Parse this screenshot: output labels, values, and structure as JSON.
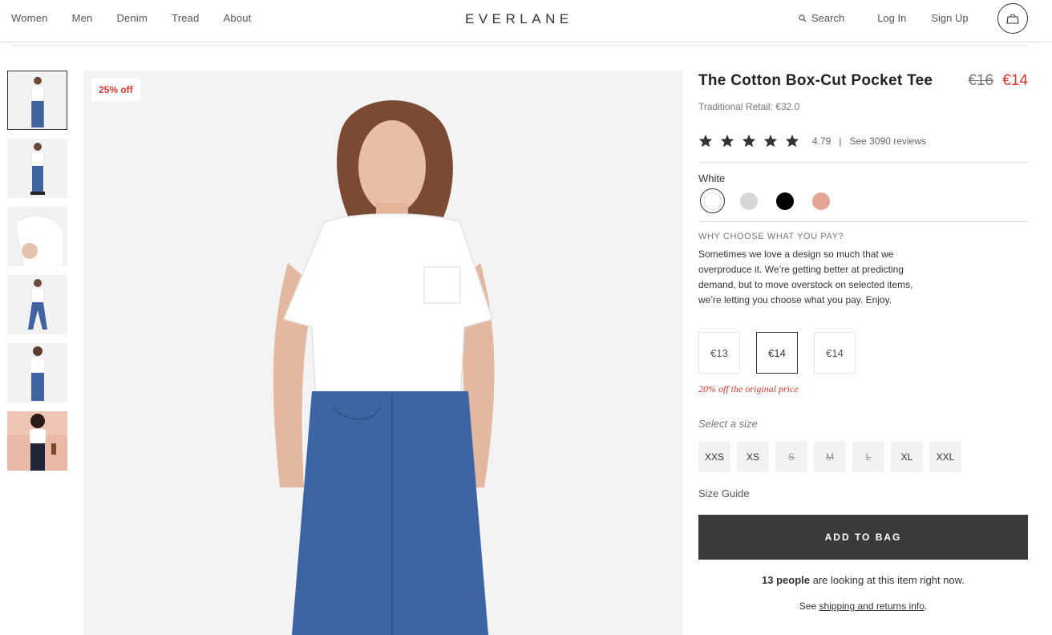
{
  "header": {
    "nav": [
      "Women",
      "Men",
      "Denim",
      "Tread",
      "About"
    ],
    "logo": "EVERLANE",
    "search_label": "Search",
    "login_label": "Log In",
    "signup_label": "Sign Up",
    "icons": {
      "search": "search-icon",
      "bag": "shopping-bag-icon"
    }
  },
  "gallery": {
    "thumbnail_count": 6,
    "selected_thumbnail": 1,
    "discount_badge": "25% off"
  },
  "product": {
    "title": "The Cotton Box-Cut Pocket Tee",
    "price_old": "€16",
    "price_new": "€14",
    "traditional_retail": "Traditional Retail: €32.0",
    "rating": "4.79",
    "rating_separator": "|",
    "reviews_label": "See 3090 reviews",
    "star_count": 5,
    "color_label": "White",
    "colors": [
      {
        "name": "White",
        "hex": "#ffffff",
        "selected": true
      },
      {
        "name": "Grey",
        "hex": "#d6d6d4",
        "selected": false
      },
      {
        "name": "Black",
        "hex": "#000000",
        "selected": false
      },
      {
        "name": "Rose",
        "hex": "#e3a595",
        "selected": false
      }
    ],
    "why_title": "WHY CHOOSE WHAT YOU PAY?",
    "why_text": "Sometimes we love a design so much that we overproduce it. We’re getting better at predicting demand, but to move overstock on selected items, we’re letting you choose what you pay. Enjoy.",
    "price_options": [
      {
        "label": "€13",
        "selected": false
      },
      {
        "label": "€14",
        "selected": true
      },
      {
        "label": "€14",
        "selected": false
      }
    ],
    "price_note": "20% off the original price",
    "size_label": "Select a size",
    "sizes": [
      {
        "label": "XXS",
        "available": true
      },
      {
        "label": "XS",
        "available": true
      },
      {
        "label": "S",
        "available": false
      },
      {
        "label": "M",
        "available": false
      },
      {
        "label": "L",
        "available": false
      },
      {
        "label": "XL",
        "available": true
      },
      {
        "label": "XXL",
        "available": true
      }
    ],
    "size_guide": "Size Guide",
    "add_to_bag": "ADD TO BAG",
    "looking_count": "13 people",
    "looking_text": " are looking at this item right now.",
    "shipping_prefix": "See ",
    "shipping_link": "shipping and returns info",
    "shipping_suffix": "."
  },
  "colors": {
    "accent_red": "#d9362f",
    "button_dark": "#3a3a3a"
  }
}
